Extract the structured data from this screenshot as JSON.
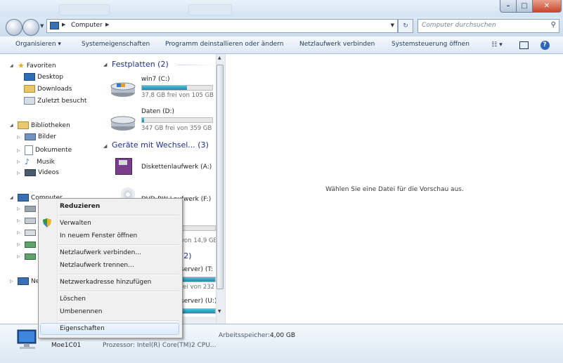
{
  "window": {
    "min_label": "–",
    "max_label": "□",
    "close_label": "✕"
  },
  "address": {
    "crumbs": [
      "Computer"
    ],
    "search_placeholder": "Computer durchsuchen"
  },
  "toolbar": {
    "organize": "Organisieren",
    "properties": "Systemeigenschaften",
    "uninstall": "Programm deinstallieren oder ändern",
    "map_drive": "Netzlaufwerk verbinden",
    "control_panel": "Systemsteuerung öffnen"
  },
  "nav": {
    "favorites": "Favoriten",
    "desktop": "Desktop",
    "downloads": "Downloads",
    "recent": "Zuletzt besucht",
    "libraries": "Bibliotheken",
    "pictures": "Bilder",
    "documents": "Dokumente",
    "music": "Musik",
    "videos": "Videos",
    "computer": "Computer",
    "network_prefix": "Ne"
  },
  "groups": {
    "hdd": "Festplatten (2)",
    "removable": "Geräte mit Wechsel... (3)",
    "network_tail": "(2)"
  },
  "drives": [
    {
      "name": "win7 (C:)",
      "sub": "37,8 GB frei von 105 GB",
      "used_fraction": 0.64,
      "color": "#26a0c4"
    },
    {
      "name": "Daten (D:)",
      "sub": "347 GB frei von 359 GB",
      "used_fraction": 0.03,
      "color": "#26a0c4"
    }
  ],
  "removable": [
    {
      "name": "Diskettenlaufwerk (A:)"
    },
    {
      "name": "DVD-RW-Laufwerk (F:)"
    }
  ],
  "partial": {
    "free1": "von 14,9 GB",
    "server1": "server) (T:",
    "free2": "rei von 232 GB",
    "server2": "server) (U:)"
  },
  "preview": {
    "text": "Wählen Sie eine Datei für die Vorschau aus."
  },
  "details": {
    "name": "Moe1C01",
    "workgroup_label": "Arbeitsspeicher:",
    "memory": "4,00 GB",
    "processor": "Prozessor: Intel(R) Core(TM)2 CPU..."
  },
  "context_menu": {
    "items": [
      "Reduzieren",
      "Verwalten",
      "In neuem Fenster öffnen",
      "Netzlaufwerk verbinden...",
      "Netzlaufwerk trennen...",
      "Netzwerkadresse hinzufügen",
      "Löschen",
      "Umbenennen",
      "Eigenschaften"
    ],
    "highlighted": "Eigenschaften"
  }
}
